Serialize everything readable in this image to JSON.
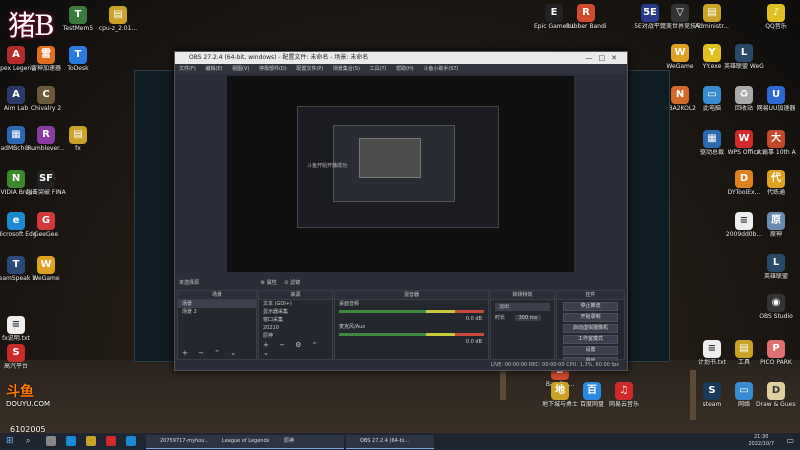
{
  "overlay": {
    "streamer_logo": "猪B",
    "platform_name": "DOUYU.COM",
    "room_number": "6102005"
  },
  "desktop_icons_left": [
    {
      "label": "TestMem5",
      "color": "#3a7a3a",
      "glyph": "T"
    },
    {
      "label": "cpu-z_2.01...",
      "color": "#c9a227",
      "glyph": "▤"
    },
    {
      "label": "Apex Legends",
      "color": "#b32b2b",
      "glyph": "A"
    },
    {
      "label": "雷神加速器",
      "color": "#e07020",
      "glyph": "雷"
    },
    {
      "label": "ToDesk",
      "color": "#2a7ae2",
      "glyph": "T"
    },
    {
      "label": "Aim Lab",
      "color": "#2a3a6a",
      "glyph": "A"
    },
    {
      "label": "Chivalry 2",
      "color": "#6a5a3a",
      "glyph": "C"
    },
    {
      "label": "BadMBchib...",
      "color": "#2a6ab2",
      "glyph": "▦"
    },
    {
      "label": "Rumblever...",
      "color": "#8a3aa2",
      "glyph": "R"
    },
    {
      "label": "fx",
      "color": "#c9a227",
      "glyph": "▤"
    },
    {
      "label": "NVIDIA Broadcast",
      "color": "#3a8a2a",
      "glyph": "N"
    },
    {
      "label": "超击突破 FINAL BETA",
      "color": "#222",
      "glyph": "SF"
    },
    {
      "label": "Microsoft Edge",
      "color": "#1a8ad2",
      "glyph": "e"
    },
    {
      "label": "GeeGee",
      "color": "#d23a3a",
      "glyph": "G"
    },
    {
      "label": "TeamSpeak 3 Client",
      "color": "#2a4a7a",
      "glyph": "T"
    },
    {
      "label": "WeGame",
      "color": "#e0a020",
      "glyph": "W"
    },
    {
      "label": "fx说明.txt",
      "color": "#eee",
      "glyph": "≡"
    },
    {
      "label": "高汽平台",
      "color": "#c92a2a",
      "glyph": "S"
    }
  ],
  "desktop_icons_right": [
    {
      "label": "Epic Games Launcher",
      "color": "#222",
      "glyph": "E"
    },
    {
      "label": "Rubber Bandits...",
      "color": "#d24a2a",
      "glyph": "R"
    },
    {
      "label": "5E对战平台",
      "color": "#2a3a8a",
      "glyph": "5E"
    },
    {
      "label": "完美世界竞技平台",
      "color": "#333",
      "glyph": "▽"
    },
    {
      "label": "Administr...",
      "color": "#c9a227",
      "glyph": "▤"
    },
    {
      "label": "QQ音乐",
      "color": "#e0c020",
      "glyph": "♪"
    },
    {
      "label": "WeGame",
      "color": "#e0a020",
      "glyph": "W"
    },
    {
      "label": "YY.exe",
      "color": "#e0c020",
      "glyph": "Y"
    },
    {
      "label": "英雄联盟 WeGame版",
      "color": "#2a4a6a",
      "glyph": "L"
    },
    {
      "label": "此电脑",
      "color": "#3a8ad2",
      "glyph": "▭"
    },
    {
      "label": "NBA2KOL2",
      "color": "#d26a2a",
      "glyph": "N"
    },
    {
      "label": "回收站",
      "color": "#aaa",
      "glyph": "♻"
    },
    {
      "label": "网易UU加速器",
      "color": "#2a6ad2",
      "glyph": "U"
    },
    {
      "label": "驱动总裁",
      "color": "#2a6ab2",
      "glyph": "▦"
    },
    {
      "label": "WPS Office",
      "color": "#d22a2a",
      "glyph": "W"
    },
    {
      "label": "大霸事 10th Anniver...",
      "color": "#c24a2a",
      "glyph": "大"
    },
    {
      "label": "DYToolEx...",
      "color": "#e08020",
      "glyph": "D"
    },
    {
      "label": "代练通",
      "color": "#e0a020",
      "glyph": "代"
    },
    {
      "label": "2009dd0b...",
      "color": "#eee",
      "glyph": "≡"
    },
    {
      "label": "原神",
      "color": "#6a8ab2",
      "glyph": "原"
    },
    {
      "label": "英雄联盟",
      "color": "#2a4a6a",
      "glyph": "L"
    },
    {
      "label": "OBS Studio",
      "color": "#333",
      "glyph": "◉"
    },
    {
      "label": "计划书.txt",
      "color": "#eee",
      "glyph": "≡"
    },
    {
      "label": "工具",
      "color": "#c9a227",
      "glyph": "▤"
    },
    {
      "label": "PICO PARK",
      "color": "#e07070",
      "glyph": "P"
    },
    {
      "label": "steam",
      "color": "#1a3a5a",
      "glyph": "S"
    },
    {
      "label": "网络",
      "color": "#3a8ad2",
      "glyph": "▭"
    },
    {
      "label": "Draw & Guess",
      "color": "#e0d0a0",
      "glyph": "D"
    },
    {
      "label": "Bandits...",
      "color": "#d24a2a",
      "glyph": "B"
    },
    {
      "label": "地下城与勇士",
      "color": "#c9a227",
      "glyph": "地"
    },
    {
      "label": "百度网盘",
      "color": "#2a8ae2",
      "glyph": "百"
    },
    {
      "label": "网易云音乐",
      "color": "#d22a2a",
      "glyph": "♫"
    }
  ],
  "obs": {
    "title": "OBS 27.2.4 (64-bit, windows) - 配置文件: 未命名 - 场景: 未命名",
    "menu": [
      "文件(F)",
      "编辑(E)",
      "视图(V)",
      "停靠部件(D)",
      "配置文件(P)",
      "场景集合(S)",
      "工具(T)",
      "帮助(H)",
      "斗鱼小助手(ST)"
    ],
    "preview_caption": "斗鱼开始开播成功",
    "no_source": "未选择源",
    "properties_btn": "属性",
    "filters_btn": "滤镜",
    "scenes": {
      "header": "场景",
      "items": [
        "场景",
        "场景 2"
      ]
    },
    "sources": {
      "header": "来源",
      "items": [
        "文本 (GDI+)",
        "显示器采集",
        "窗口采集",
        "20210",
        "原神"
      ]
    },
    "mixer": {
      "header": "混音器",
      "tracks": [
        {
          "name": "桌面音频",
          "level": "0.0 dB"
        },
        {
          "name": "麦克风/Aux",
          "level": "0.0 dB"
        }
      ]
    },
    "transitions": {
      "header": "转场特效",
      "type": "淡出",
      "duration_label": "时长",
      "duration": "300 ms"
    },
    "controls": {
      "header": "控件",
      "buttons": [
        "停止推流",
        "开始录制",
        "启动虚拟摄像机",
        "工作室模式",
        "设置",
        "退出"
      ]
    },
    "status": "LIVE: 00:00:00   REC: 00:00:00   CPU: 1.3%, 60.00 fps"
  },
  "taskbar": {
    "items": [
      "20759717-myhou...",
      "League of Legends",
      "原神",
      "OBS 27.2.4 (64-bi..."
    ],
    "time": "21:30",
    "date": "2022/10/7"
  }
}
